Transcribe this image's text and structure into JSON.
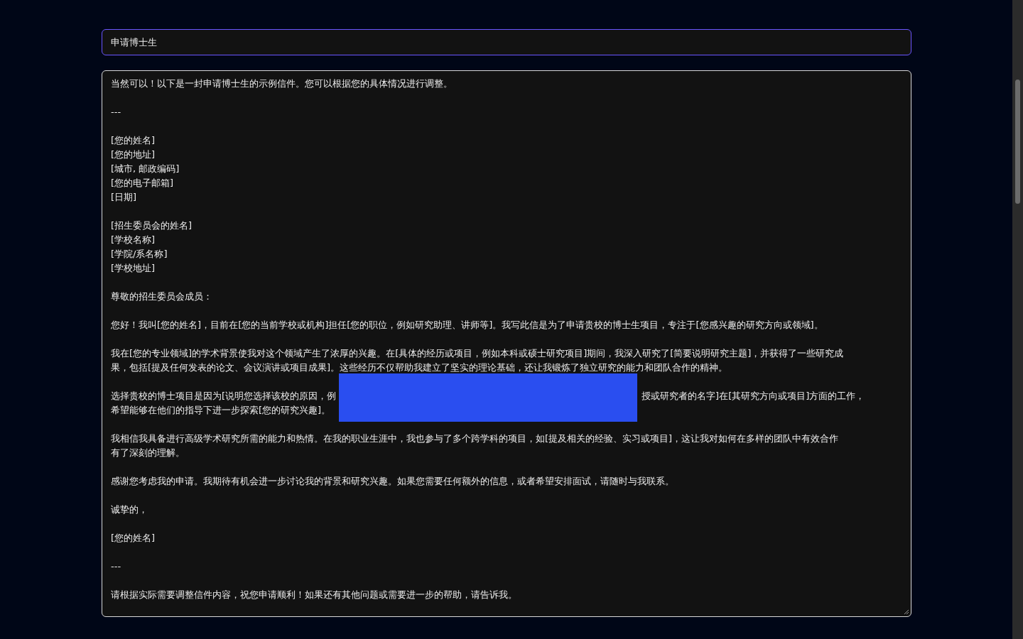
{
  "title_field": {
    "value": "申请博士生"
  },
  "message": {
    "paragraphs": [
      {
        "kind": "text",
        "lines": [
          "当然可以！以下是一封申请博士生的示例信件。您可以根据您的具体情况进行调整。"
        ]
      },
      {
        "kind": "text",
        "lines": [
          "---"
        ]
      },
      {
        "kind": "text",
        "lines": [
          "[您的姓名]",
          "[您的地址]",
          "[城市, 邮政编码]",
          "[您的电子邮箱]",
          "[日期]"
        ]
      },
      {
        "kind": "text",
        "lines": [
          "[招生委员会的姓名]",
          "[学校名称]",
          "[学院/系名称]",
          "[学校地址]"
        ]
      },
      {
        "kind": "text",
        "lines": [
          "尊敬的招生委员会成员："
        ]
      },
      {
        "kind": "text",
        "lines": [
          "您好！我叫[您的姓名]，目前在[您的当前学校或机构]担任[您的职位，例如研究助理、讲师等]。我写此信是为了申请贵校的博士生项目，专注于[您感兴趣的研究方向或领域]。"
        ]
      },
      {
        "kind": "text",
        "lines": [
          "我在[您的专业领域]的学术背景使我对这个领域产生了浓厚的兴趣。在[具体的经历或项目，例如本科或硕士研究项目]期间，我深入研究了[简要说明研究主题]，并获得了一些研究成",
          "果，包括[提及任何发表的论文、会议演讲或项目成果]。这些经历不仅帮助我建立了坚实的理论基础，还让我锻炼了独立研究的能力和团队合作的精神。"
        ]
      },
      {
        "kind": "redacted",
        "lead": "选择贵校的博士项目是因为[说明您选择该校的原因，例",
        "tail": "授或研究者的名字]在[其研究方向或项目]方面的工作，",
        "lines": [
          "希望能够在他们的指导下进一步探索[您的研究兴趣]。"
        ]
      },
      {
        "kind": "text",
        "lines": [
          "我相信我具备进行高级学术研究所需的能力和热情。在我的职业生涯中，我也参与了多个跨学科的项目，如[提及相关的经验、实习或项目]，这让我对如何在多样的团队中有效合作",
          "有了深刻的理解。"
        ]
      },
      {
        "kind": "text",
        "lines": [
          "感谢您考虑我的申请。我期待有机会进一步讨论我的背景和研究兴趣。如果您需要任何额外的信息，或者希望安排面试，请随时与我联系。"
        ]
      },
      {
        "kind": "text",
        "lines": [
          "诚挚的，"
        ]
      },
      {
        "kind": "text",
        "lines": [
          "[您的姓名]"
        ]
      },
      {
        "kind": "text",
        "lines": [
          "---"
        ]
      },
      {
        "kind": "text",
        "lines": [
          "请根据实际需要调整信件内容，祝您申请顺利！如果还有其他问题或需要进一步的帮助，请告诉我。"
        ]
      }
    ]
  }
}
